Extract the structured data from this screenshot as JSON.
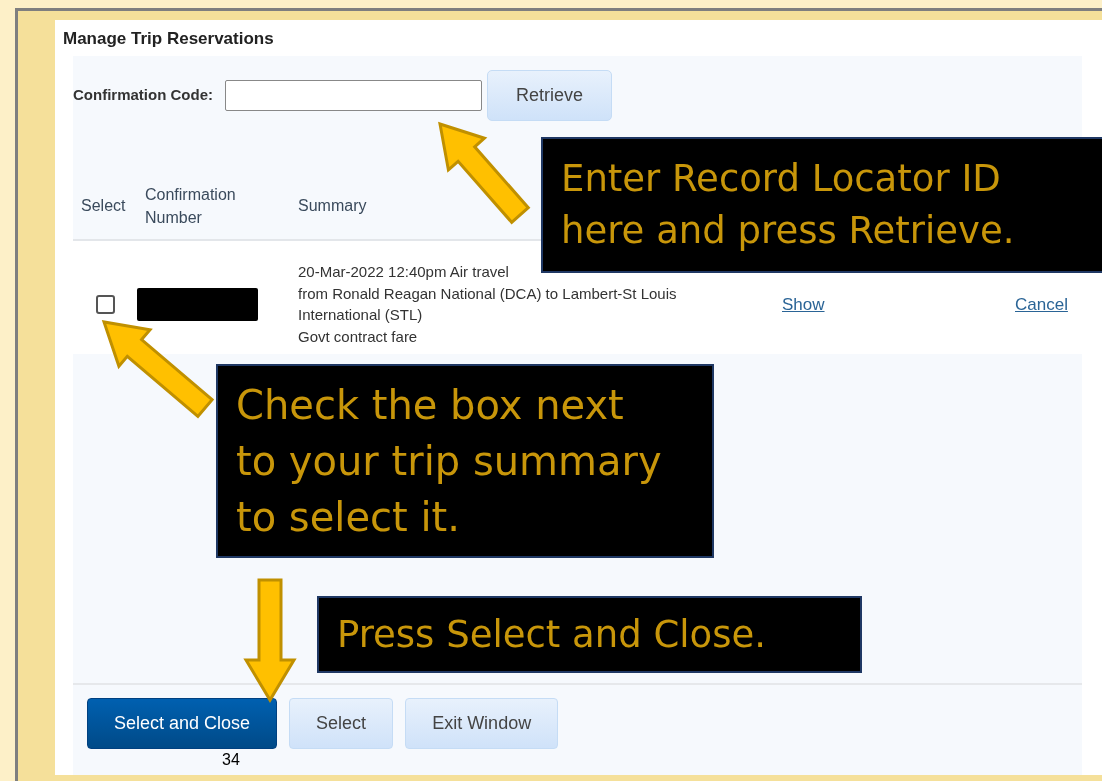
{
  "title": "Manage Trip Reservations",
  "confirmation_field": {
    "label": "Confirmation Code:",
    "button": "Retrieve"
  },
  "table": {
    "columns": [
      "Select",
      "Confirmation Number",
      "Summary"
    ],
    "rows": [
      {
        "checked": false,
        "summary": [
          "20-Mar-2022 12:40pm Air travel",
          "from Ronald Reagan National (DCA) to Lambert-St Louis International (STL)",
          "Govt contract fare"
        ],
        "actions": [
          "Show",
          "Cancel"
        ]
      }
    ]
  },
  "buttons": [
    {
      "label": "Select and Close",
      "primary": true
    },
    {
      "label": "Select",
      "primary": false
    },
    {
      "label": "Exit Window",
      "primary": false
    }
  ],
  "callouts": [
    [
      "Enter Record Locator ID",
      "here and press Retrieve."
    ],
    [
      "Check the box next",
      "to your trip summary",
      "to select it."
    ],
    [
      "Press Select and Close."
    ]
  ],
  "slide_number": "34"
}
